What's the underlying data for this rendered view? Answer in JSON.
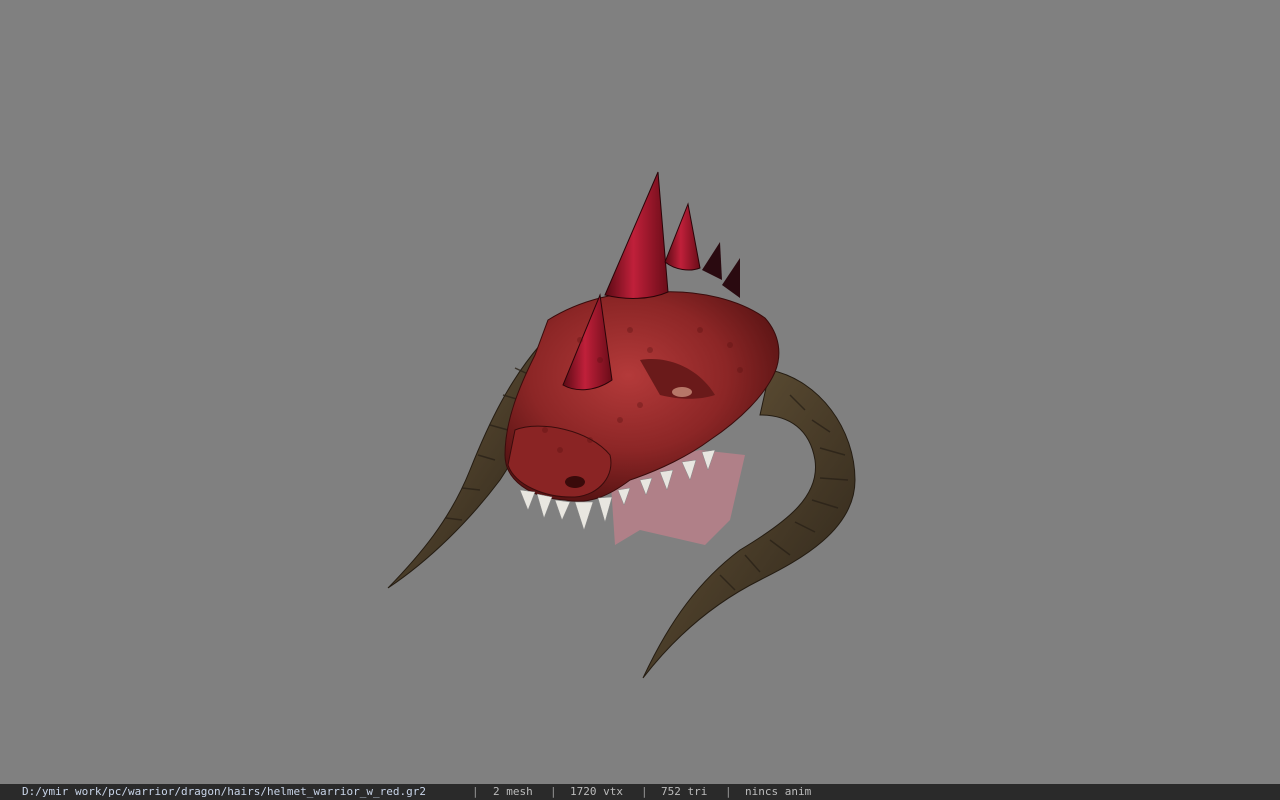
{
  "viewer": {
    "background_color": "#808080",
    "model_icon": "dragon-helmet-model"
  },
  "status": {
    "file_path": "D:/ymir work/pc/warrior/dragon/hairs/helmet_warrior_w_red.gr2",
    "separator": "|",
    "mesh": "2 mesh",
    "vertices": "1720 vtx",
    "triangles": "752 tri",
    "anim": "nincs anim"
  }
}
